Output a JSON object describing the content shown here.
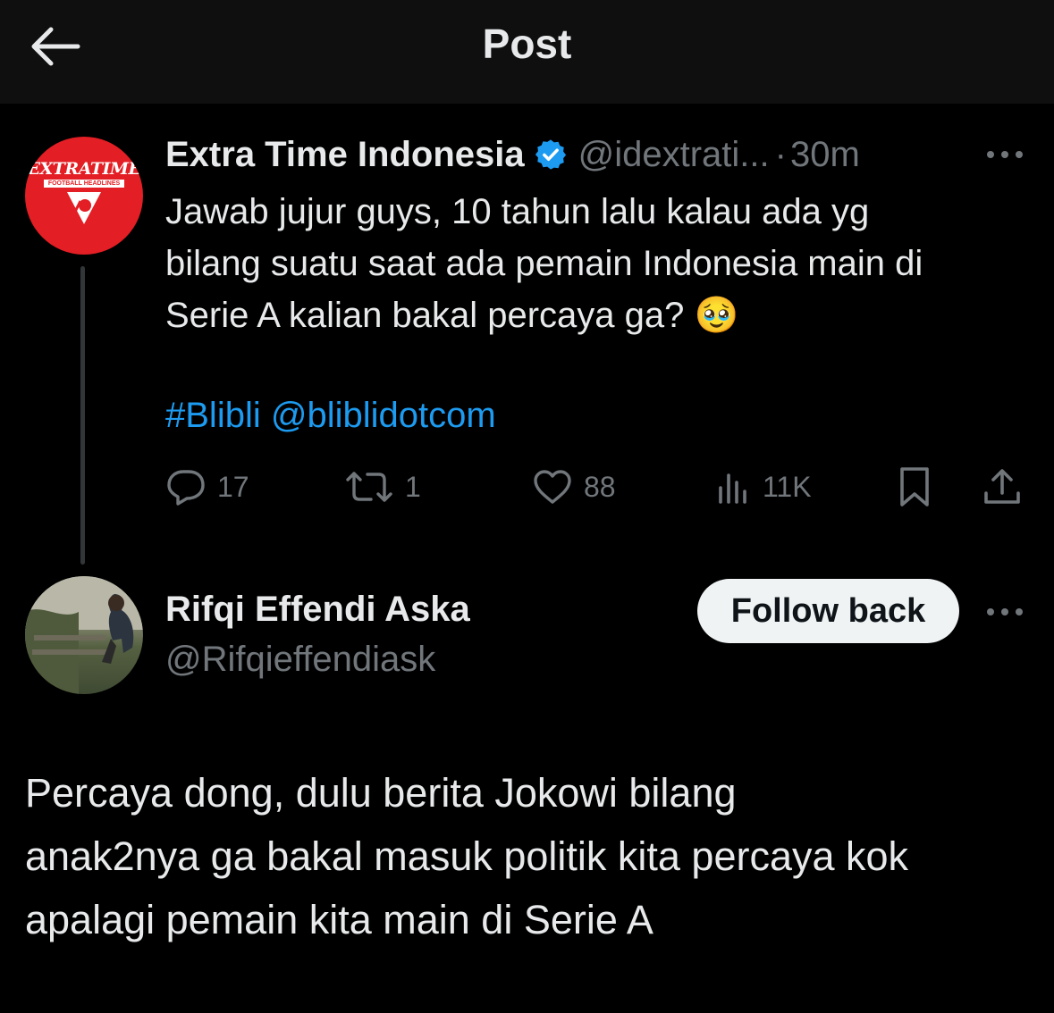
{
  "header": {
    "title": "Post",
    "back_icon": "arrow-left-icon"
  },
  "parent_tweet": {
    "avatar_logo_title": "EXTRATIME",
    "avatar_logo_subtitle": "FOOTBALL HEADLINES",
    "author_name": "Extra Time Indonesia",
    "verified": true,
    "handle": "@idextrati...",
    "separator": "·",
    "time": "30m",
    "text_lines": [
      "Jawab jujur guys, 10 tahun lalu kalau ada yg",
      "bilang suatu saat ada pemain Indonesia main di",
      "Serie A kalian bakal percaya ga? 🥹"
    ],
    "hashtag": "#Blibli",
    "mention": "@bliblidotcom",
    "actions": {
      "replies": "17",
      "reposts": "1",
      "likes": "88",
      "views": "11K"
    }
  },
  "reply": {
    "author_name": "Rifqi Effendi Aska",
    "handle": "@Rifqieffendiask",
    "follow_label": "Follow back",
    "text_lines": [
      "Percaya dong, dulu berita Jokowi bilang",
      "anak2nya ga bakal masuk politik kita percaya kok",
      "apalagi pemain kita main di Serie A"
    ]
  },
  "colors": {
    "background": "#000000",
    "header": "#0f0f0f",
    "text": "#e7e9ea",
    "secondary": "#71767b",
    "link": "#1d9bf0",
    "verified": "#1d9bf0",
    "avatar_red": "#e31e24"
  }
}
